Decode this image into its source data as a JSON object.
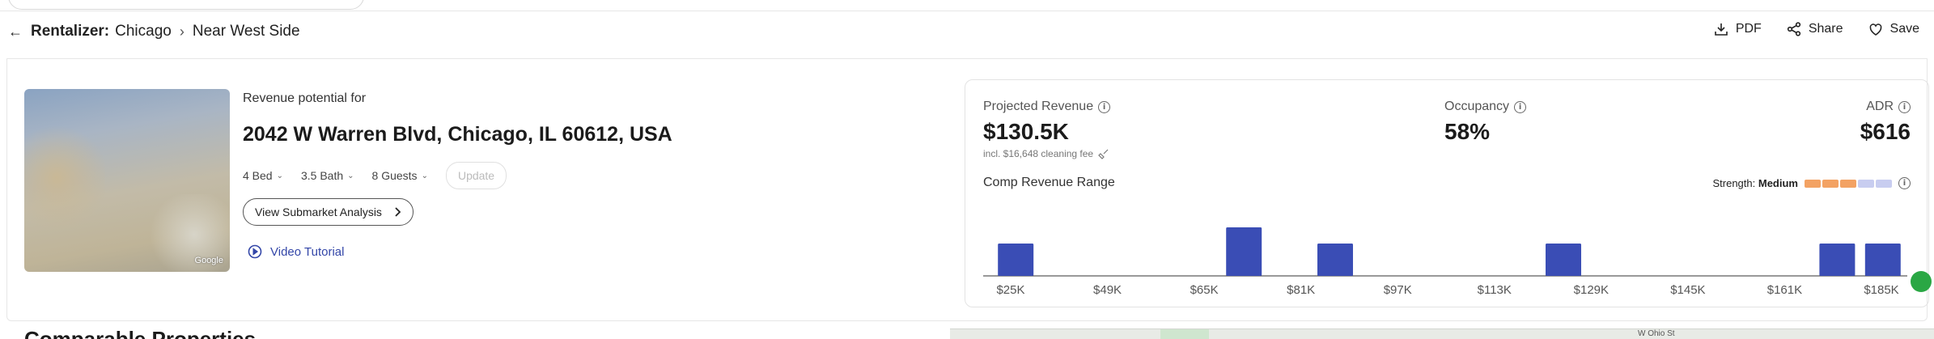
{
  "breadcrumb": {
    "back_icon": "arrow-left-icon",
    "root": "Rentalizer:",
    "city": "Chicago",
    "neighborhood": "Near West Side"
  },
  "actions": {
    "pdf": "PDF",
    "share": "Share",
    "save": "Save"
  },
  "property": {
    "revenue_label": "Revenue potential for",
    "address": "2042 W Warren Blvd, Chicago, IL 60612, USA",
    "beds": "4 Bed",
    "baths": "3.5 Bath",
    "guests": "8 Guests",
    "update_label": "Update",
    "submarket_label": "View Submarket Analysis",
    "video_label": "Video Tutorial",
    "photo_credit": "Google"
  },
  "metrics": {
    "projected_label": "Projected Revenue",
    "projected_value": "$130.5K",
    "cleaning_note": "incl. $16,648 cleaning fee",
    "occupancy_label": "Occupancy",
    "occupancy_value": "58%",
    "adr_label": "ADR",
    "adr_value": "$616"
  },
  "comp_range": {
    "title": "Comp Revenue Range",
    "strength_label": "Strength:",
    "strength_value": "Medium",
    "strength_colors": [
      "#f3a263",
      "#f3a263",
      "#f3a263",
      "#c8cdf0",
      "#c8cdf0"
    ]
  },
  "chart_data": {
    "type": "bar",
    "x_ticks": [
      "$25K",
      "$49K",
      "$65K",
      "$81K",
      "$97K",
      "$113K",
      "$129K",
      "$145K",
      "$161K",
      "$185K"
    ],
    "bins": 19,
    "values": [
      2,
      0,
      0,
      0,
      0,
      3,
      0,
      2,
      0,
      0,
      0,
      0,
      2,
      0,
      0,
      0,
      0,
      0,
      2,
      2
    ],
    "bar_color": "#3a4db5",
    "grid": false
  },
  "sections": {
    "comparable_title": "Comparable Properties",
    "map_street": "W Ohio St"
  }
}
